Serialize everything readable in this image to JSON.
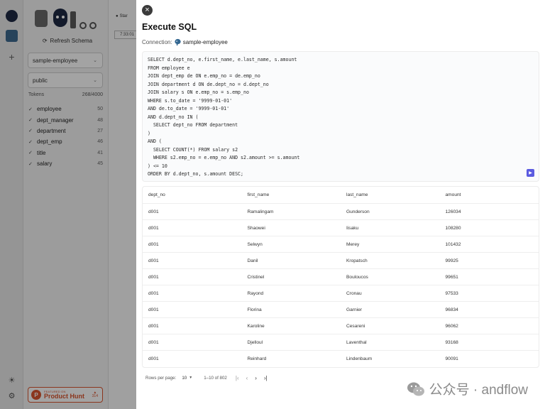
{
  "app": {
    "refresh_label": "Refresh Schema",
    "connection_select": "sample-employee",
    "schema_select": "public",
    "tokens_label": "Tokens",
    "tokens_value": "268/4000",
    "tables": [
      {
        "name": "employee",
        "count": "50"
      },
      {
        "name": "dept_manager",
        "count": "48"
      },
      {
        "name": "department",
        "count": "27"
      },
      {
        "name": "dept_emp",
        "count": "46"
      },
      {
        "name": "title",
        "count": "41"
      },
      {
        "name": "salary",
        "count": "45"
      }
    ],
    "star_label": "Star",
    "time_label": "7:33:01",
    "product_hunt": {
      "featured": "FEATURED ON",
      "name": "Product Hunt",
      "count": "314"
    }
  },
  "drawer": {
    "title": "Execute SQL",
    "connection_label": "Connection:",
    "connection_name": "sample-employee",
    "sql_lines": [
      "SELECT d.dept_no, e.first_name, e.last_name, s.amount",
      "FROM employee e",
      "JOIN dept_emp de ON e.emp_no = de.emp_no",
      "JOIN department d ON de.dept_no = d.dept_no",
      "JOIN salary s ON e.emp_no = s.emp_no",
      "WHERE s.to_date = '9999-01-01'",
      "AND de.to_date = '9999-01-01'",
      "AND d.dept_no IN (",
      "  SELECT dept_no FROM department",
      ")",
      "AND (",
      "  SELECT COUNT(*) FROM salary s2",
      "  WHERE s2.emp_no = e.emp_no AND s2.amount >= s.amount",
      ") <= 10",
      "ORDER BY d.dept_no, s.amount DESC;"
    ],
    "columns": [
      "dept_no",
      "first_name",
      "last_name",
      "amount"
    ],
    "rows": [
      [
        "d001",
        "Ramalingam",
        "Gunderson",
        "126034"
      ],
      [
        "d001",
        "Shaowei",
        "Iisaku",
        "108280"
      ],
      [
        "d001",
        "Selwyn",
        "Merey",
        "101432"
      ],
      [
        "d001",
        "Danil",
        "Kropatsch",
        "99925"
      ],
      [
        "d001",
        "Cristinel",
        "Bouloucos",
        "99651"
      ],
      [
        "d001",
        "Rayond",
        "Cronau",
        "97533"
      ],
      [
        "d001",
        "Florina",
        "Garnier",
        "96834"
      ],
      [
        "d001",
        "Karoline",
        "Cesareni",
        "96062"
      ],
      [
        "d001",
        "Djelloul",
        "Laventhal",
        "93168"
      ],
      [
        "d001",
        "Reinhard",
        "Lindenbaum",
        "90091"
      ]
    ],
    "pager": {
      "rows_per_page_label": "Rows per page:",
      "rows_per_page_value": "10",
      "range": "1–10 of 802"
    }
  },
  "watermark": {
    "text": "公众号 · andflow"
  },
  "colors": {
    "accent": "#5b5be0",
    "product_hunt": "#da552f"
  }
}
